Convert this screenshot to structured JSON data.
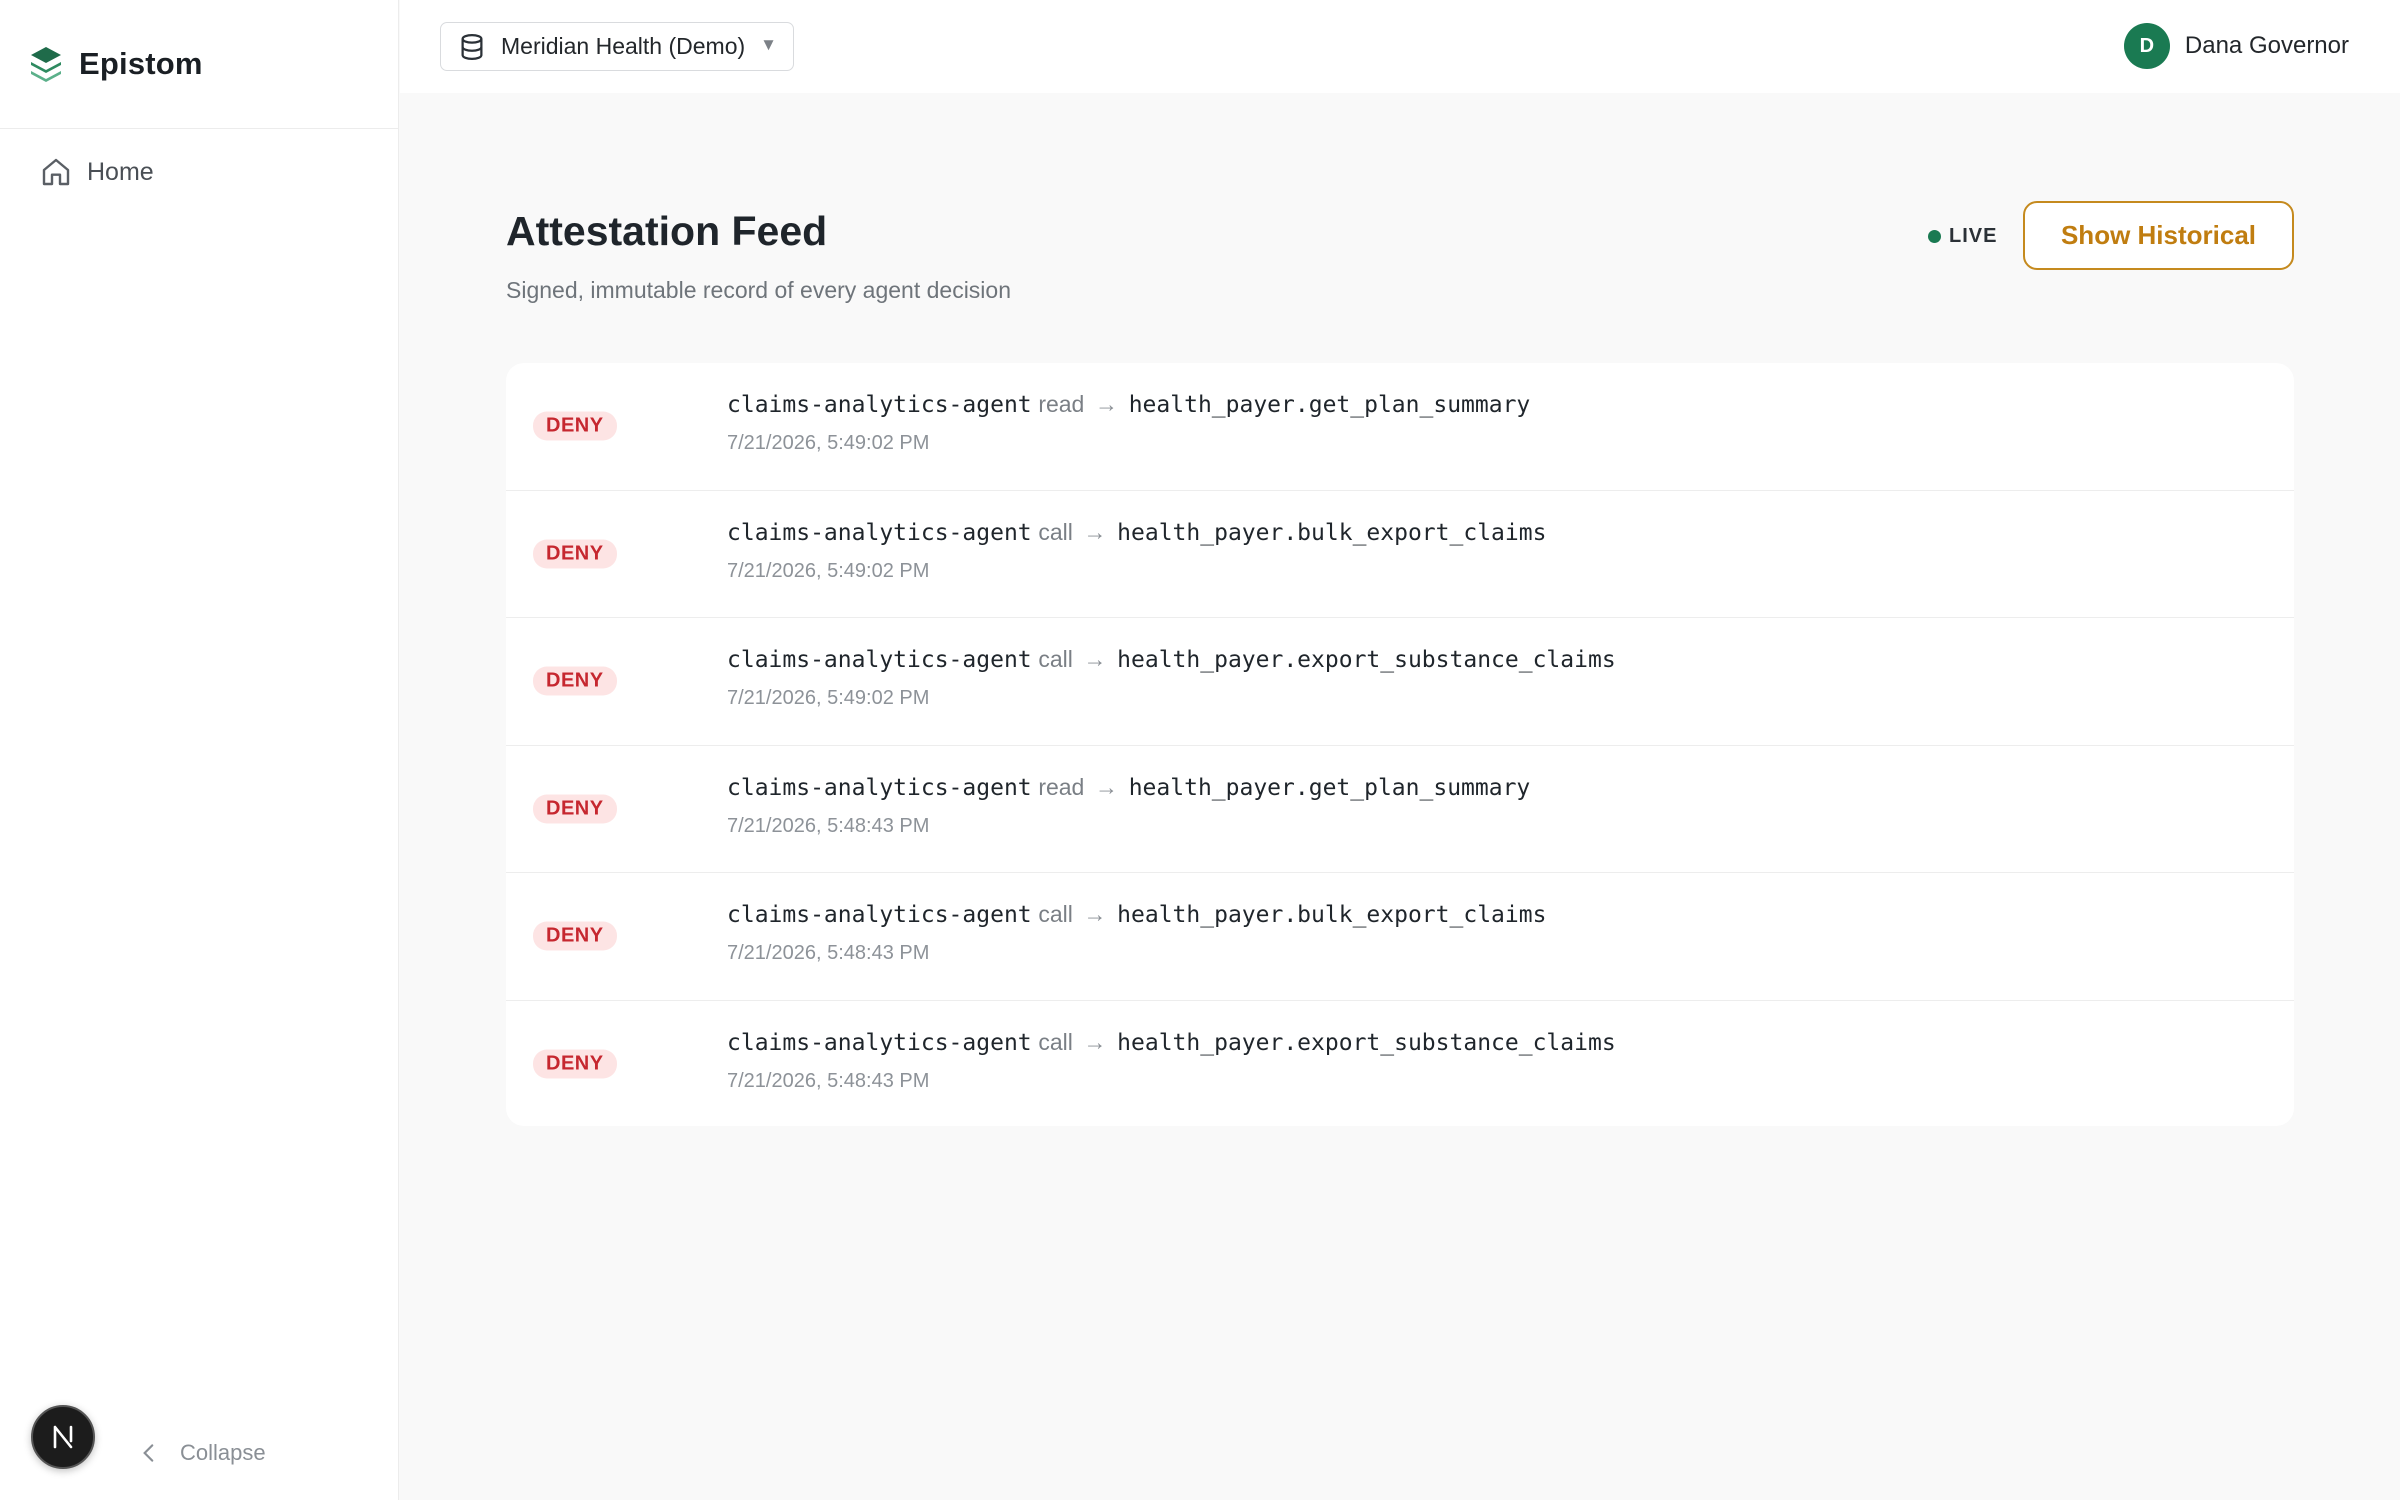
{
  "sidebar": {
    "brand": "Epistom",
    "nav": [
      {
        "label": "Home",
        "icon": "home-icon"
      }
    ],
    "collapse_label": "Collapse",
    "badge_letter": "N"
  },
  "topbar": {
    "org_select": {
      "value": "Meridian Health (Demo)",
      "icon": "database-icon"
    },
    "user": {
      "initial": "D",
      "name": "Dana Governor"
    }
  },
  "main": {
    "title": "Attestation Feed",
    "subtitle": "Signed, immutable record of every agent decision",
    "live_label": "LIVE",
    "historical_button": "Show Historical"
  },
  "feed": [
    {
      "decision": "DENY",
      "agent": "claims-analytics-agent",
      "verb": "read",
      "arrow": "→",
      "target": "health_payer.get_plan_summary",
      "timestamp": "7/21/2026, 5:49:02 PM"
    },
    {
      "decision": "DENY",
      "agent": "claims-analytics-agent",
      "verb": "call",
      "arrow": "→",
      "target": "health_payer.bulk_export_claims",
      "timestamp": "7/21/2026, 5:49:02 PM"
    },
    {
      "decision": "DENY",
      "agent": "claims-analytics-agent",
      "verb": "call",
      "arrow": "→",
      "target": "health_payer.export_substance_claims",
      "timestamp": "7/21/2026, 5:49:02 PM"
    },
    {
      "decision": "DENY",
      "agent": "claims-analytics-agent",
      "verb": "read",
      "arrow": "→",
      "target": "health_payer.get_plan_summary",
      "timestamp": "7/21/2026, 5:48:43 PM"
    },
    {
      "decision": "DENY",
      "agent": "claims-analytics-agent",
      "verb": "call",
      "arrow": "→",
      "target": "health_payer.bulk_export_claims",
      "timestamp": "7/21/2026, 5:48:43 PM"
    },
    {
      "decision": "DENY",
      "agent": "claims-analytics-agent",
      "verb": "call",
      "arrow": "→",
      "target": "health_payer.export_substance_claims",
      "timestamp": "7/21/2026, 5:48:43 PM"
    }
  ],
  "colors": {
    "accent_green": "#1a7a52",
    "deny_bg": "#fde4e4",
    "deny_text": "#c6272f",
    "historical_border": "#c58a1e"
  }
}
